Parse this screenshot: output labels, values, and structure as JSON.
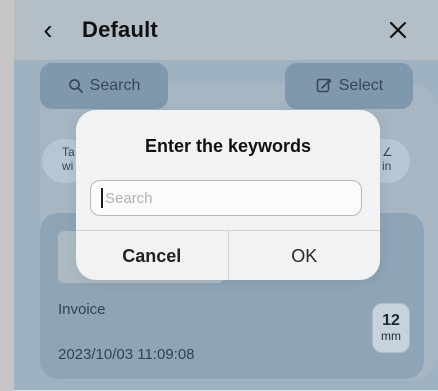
{
  "header": {
    "title": "Default",
    "back_icon": "chevron-left-icon",
    "close_icon": "close-icon"
  },
  "toolbar": {
    "search_label": "Search",
    "search_icon": "search-icon",
    "select_label": "Select",
    "select_icon": "edit-icon"
  },
  "chips": {
    "left_line1": "Ta",
    "left_line2": "wi",
    "right_line1": "∠",
    "right_line2": "in"
  },
  "card": {
    "title": "Invoice",
    "timestamp": "2023/10/03 11:09:08",
    "tape_width": "12",
    "tape_unit": "mm"
  },
  "modal": {
    "title": "Enter the keywords",
    "input_placeholder": "Search",
    "input_value": "",
    "cancel_label": "Cancel",
    "ok_label": "OK"
  },
  "colors": {
    "modal_bg": "#f1f2f3",
    "dimmed_bg": "#9fb2c2"
  }
}
